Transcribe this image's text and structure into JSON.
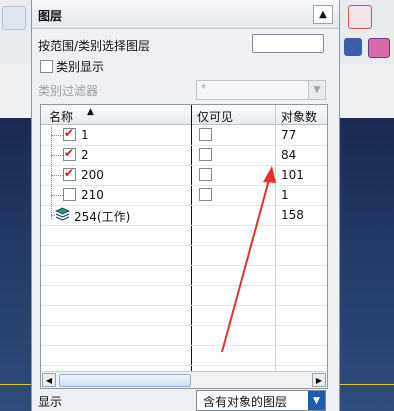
{
  "dialog": {
    "title": "图层",
    "select_by_range_label": "按范围/类别选择图层",
    "select_by_range_value": "",
    "category_display_label": "类别显示",
    "category_display_checked": false,
    "category_filter_label": "类别过滤器",
    "category_filter_value": "*",
    "columns": {
      "name": "名称",
      "visible_only": "仅可见",
      "object_count": "对象数"
    },
    "rows": [
      {
        "name": "1",
        "checked": true,
        "visible_only": false,
        "count": "77"
      },
      {
        "name": "2",
        "checked": true,
        "visible_only": false,
        "count": "84"
      },
      {
        "name": "200",
        "checked": true,
        "visible_only": false,
        "count": "101"
      },
      {
        "name": "210",
        "checked": false,
        "visible_only": false,
        "count": "1"
      },
      {
        "name": "254(工作)",
        "work_layer": true,
        "count": "158"
      }
    ],
    "display_label": "显示",
    "display_value": "含有对象的图层"
  },
  "colors": {
    "accent_red": "#e53030",
    "check_red": "#c62222",
    "select_blue": "#1e5bb0"
  }
}
